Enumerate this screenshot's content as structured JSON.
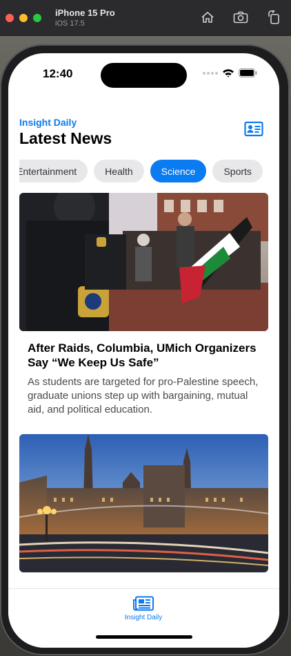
{
  "simulator": {
    "device_name": "iPhone 15 Pro",
    "os_version": "iOS 17.5",
    "tools": [
      "home-icon",
      "screenshot-icon",
      "rotate-icon"
    ]
  },
  "status_bar": {
    "time": "12:40"
  },
  "header": {
    "subtitle": "Insight Daily",
    "title": "Latest News",
    "profile_icon": "contact-card-icon"
  },
  "categories": {
    "items": [
      "Entertainment",
      "Health",
      "Science",
      "Sports"
    ],
    "selected": "Science"
  },
  "articles": [
    {
      "headline": "After Raids, Columbia, UMich Organizers Say “We Keep Us Safe”",
      "summary": "As students are targeted for pro-Palestine speech, graduate unions step up with bargaining, mutual aid, and political education.",
      "image": "protest-photo"
    },
    {
      "headline": "",
      "summary": "",
      "image": "parliament-photo"
    }
  ],
  "tab_bar": {
    "items": [
      {
        "label": "Insight Daily",
        "icon": "newspaper-icon"
      }
    ]
  },
  "colors": {
    "accent": "#0a7bf0",
    "chip_bg": "#e8e8ea"
  }
}
